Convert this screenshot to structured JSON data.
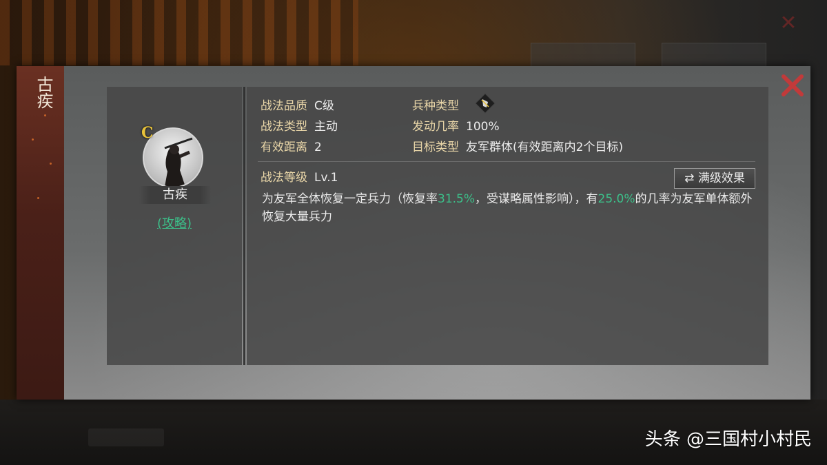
{
  "modal": {
    "side_title": "古疾",
    "close_icon": "close-x-icon"
  },
  "skill_card": {
    "grade": "C",
    "name": "古疾",
    "strategy_link": "(攻略)"
  },
  "info": {
    "quality_label": "战法品质",
    "quality_value": "C级",
    "troop_type_label": "兵种类型",
    "troop_type_icon": "shield-icon",
    "skill_type_label": "战法类型",
    "skill_type_value": "主动",
    "trigger_rate_label": "发动几率",
    "trigger_rate_value": "100%",
    "range_label": "有效距离",
    "range_value": "2",
    "target_type_label": "目标类型",
    "target_type_value": "友军群体(有效距离内2个目标)",
    "level_label": "战法等级",
    "level_value": "Lv.1",
    "max_level_button": "满级效果",
    "max_level_icon": "swap-arrows-icon",
    "desc_part1": "为友军全体恢复一定兵力（恢复率",
    "desc_rate1": "31.5%",
    "desc_part2": "，受谋略属性影响），有",
    "desc_rate2": "25.0%",
    "desc_part3": "的几率为友军单体额外恢复大量兵力"
  },
  "watermark": "头条 @三国村小村民",
  "colors": {
    "label_gold": "#e9d6a8",
    "highlight_green": "#3cc08a",
    "grade_yellow": "#e8c23a",
    "close_red": "#c23a3a"
  }
}
